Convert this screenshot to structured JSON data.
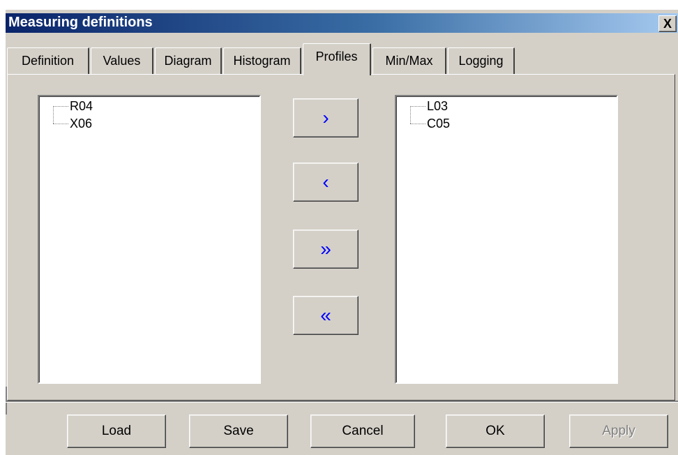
{
  "window": {
    "title": "Measuring definitions",
    "close_label": "X"
  },
  "tabs": [
    {
      "label": "Definition",
      "active": false
    },
    {
      "label": "Values",
      "active": false
    },
    {
      "label": "Diagram",
      "active": false
    },
    {
      "label": "Histogram",
      "active": false
    },
    {
      "label": "Profiles",
      "active": true
    },
    {
      "label": "Min/Max",
      "active": false
    },
    {
      "label": "Logging",
      "active": false
    }
  ],
  "left_list": {
    "items": [
      "R04",
      "X06"
    ]
  },
  "right_list": {
    "items": [
      "L03",
      "C05"
    ]
  },
  "transfer_buttons": {
    "move_right": "›",
    "move_left": "‹",
    "move_all_right": "»",
    "move_all_left": "«"
  },
  "footer": {
    "load": "Load",
    "save": "Save",
    "cancel": "Cancel",
    "ok": "OK",
    "apply": "Apply"
  },
  "colors": {
    "accent_arrows": "#0000ff",
    "title_gradient_start": "#0a246a",
    "title_gradient_end": "#a6caf0",
    "face": "#d4d0c8"
  }
}
